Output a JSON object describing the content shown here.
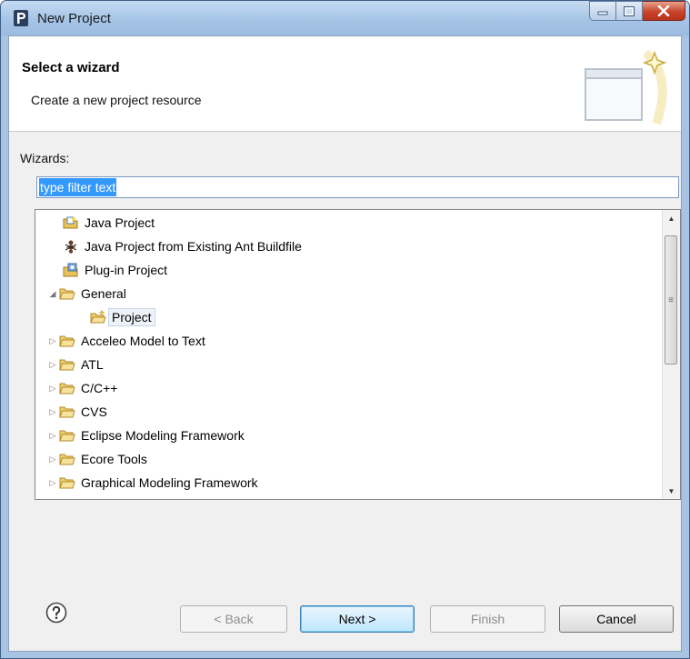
{
  "window": {
    "title": "New Project",
    "app_icon": "eclipse-p-icon",
    "controls": [
      "minimize-icon",
      "maximize-icon",
      "close-icon"
    ]
  },
  "header": {
    "title": "Select a wizard",
    "description": "Create a new project resource",
    "banner_icon": "wizard-banner-icon"
  },
  "wizards_label": "Wizards:",
  "filter": {
    "value": "type filter text"
  },
  "tree": {
    "items": [
      {
        "label": "Java Project",
        "icon": "java-project-icon",
        "expander": "none",
        "level": 0
      },
      {
        "label": "Java Project from Existing Ant Buildfile",
        "icon": "ant-icon",
        "expander": "none",
        "level": 0
      },
      {
        "label": "Plug-in Project",
        "icon": "plugin-project-icon",
        "expander": "none",
        "level": 0
      },
      {
        "label": "General",
        "icon": "folder-icon",
        "expander": "expanded",
        "level": 0
      },
      {
        "label": "Project",
        "icon": "new-project-icon",
        "expander": "none",
        "level": 1,
        "selected": true
      },
      {
        "label": "Acceleo Model to Text",
        "icon": "folder-icon",
        "expander": "collapsed",
        "level": 0
      },
      {
        "label": "ATL",
        "icon": "folder-icon",
        "expander": "collapsed",
        "level": 0
      },
      {
        "label": "C/C++",
        "icon": "folder-icon",
        "expander": "collapsed",
        "level": 0
      },
      {
        "label": "CVS",
        "icon": "folder-icon",
        "expander": "collapsed",
        "level": 0
      },
      {
        "label": "Eclipse Modeling Framework",
        "icon": "folder-icon",
        "expander": "collapsed",
        "level": 0
      },
      {
        "label": "Ecore Tools",
        "icon": "folder-icon",
        "expander": "collapsed",
        "level": 0
      },
      {
        "label": "Graphical Modeling Framework",
        "icon": "folder-icon",
        "expander": "collapsed",
        "level": 0
      }
    ]
  },
  "buttons": {
    "back": "< Back",
    "next": "Next >",
    "finish": "Finish",
    "cancel": "Cancel",
    "help_icon": "help-icon"
  }
}
